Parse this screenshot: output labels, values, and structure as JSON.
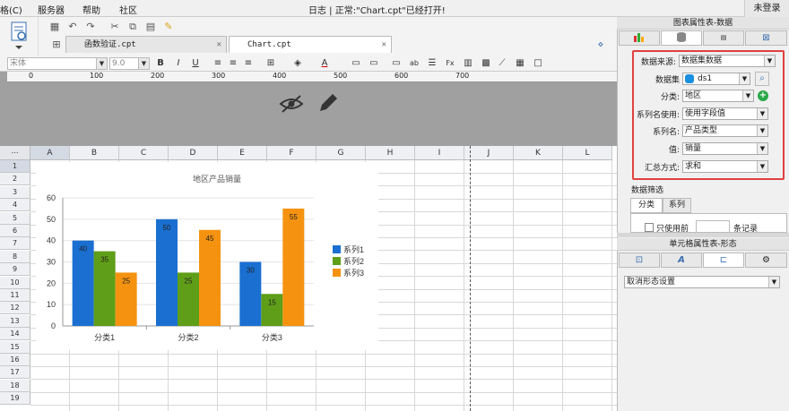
{
  "menu": {
    "items": [
      "格(C)",
      "服务器",
      "帮助",
      "社区"
    ],
    "status": "日志 | 正常:\"Chart.cpt\"已经打开!",
    "login": "未登录"
  },
  "tabs": [
    {
      "label": "函数验证.cpt"
    },
    {
      "label": "Chart.cpt"
    }
  ],
  "format": {
    "font": "宋体",
    "size": "9.0",
    "bold": "B",
    "italic": "I",
    "underline": "U"
  },
  "ruler_ticks": [
    "0",
    "100",
    "200",
    "300",
    "400",
    "500",
    "600",
    "700"
  ],
  "columns": [
    "A",
    "B",
    "C",
    "D",
    "E",
    "F",
    "G",
    "H",
    "I",
    "J",
    "K",
    "L"
  ],
  "rows": [
    "1",
    "2",
    "3",
    "4",
    "5",
    "6",
    "7",
    "8",
    "9",
    "10",
    "11",
    "12",
    "13",
    "14",
    "15",
    "16",
    "17",
    "18",
    "19"
  ],
  "colors": {
    "accent": "#1a6fd1",
    "series": [
      "#1a6fd1",
      "#5f9e18",
      "#f59210"
    ],
    "highlight": "#e04040"
  },
  "chart_data": {
    "type": "bar",
    "title": "地区产品销量",
    "categories": [
      "分类1",
      "分类2",
      "分类3"
    ],
    "series": [
      {
        "name": "系列1",
        "values": [
          40,
          50,
          30
        ]
      },
      {
        "name": "系列2",
        "values": [
          35,
          25,
          15
        ]
      },
      {
        "name": "系列3",
        "values": [
          25,
          45,
          55
        ]
      }
    ],
    "yticks": [
      "0",
      "10",
      "20",
      "30",
      "40",
      "50",
      "60"
    ],
    "ylim": [
      0,
      60
    ],
    "legend": "right"
  },
  "panel": {
    "title": "图表属性表-数据",
    "source_label": "数据来源:",
    "source_value": "数据集数据",
    "dataset_label": "数据集",
    "dataset_value": "ds1",
    "category_label": "分类:",
    "category_value": "地区",
    "seriesname_use_label": "系列名使用:",
    "seriesname_use_value": "使用字段值",
    "seriesname_label": "系列名:",
    "seriesname_value": "产品类型",
    "value_label": "值:",
    "value_value": "销量",
    "summary_label": "汇总方式:",
    "summary_value": "求和",
    "filter_title": "数据筛选",
    "filter_tab1": "分类",
    "filter_tab2": "系列",
    "only_use_label": "只使用前",
    "records_label": "条记录",
    "cell_title": "单元格属性表-形态",
    "cell_select": "取消形态设置"
  }
}
